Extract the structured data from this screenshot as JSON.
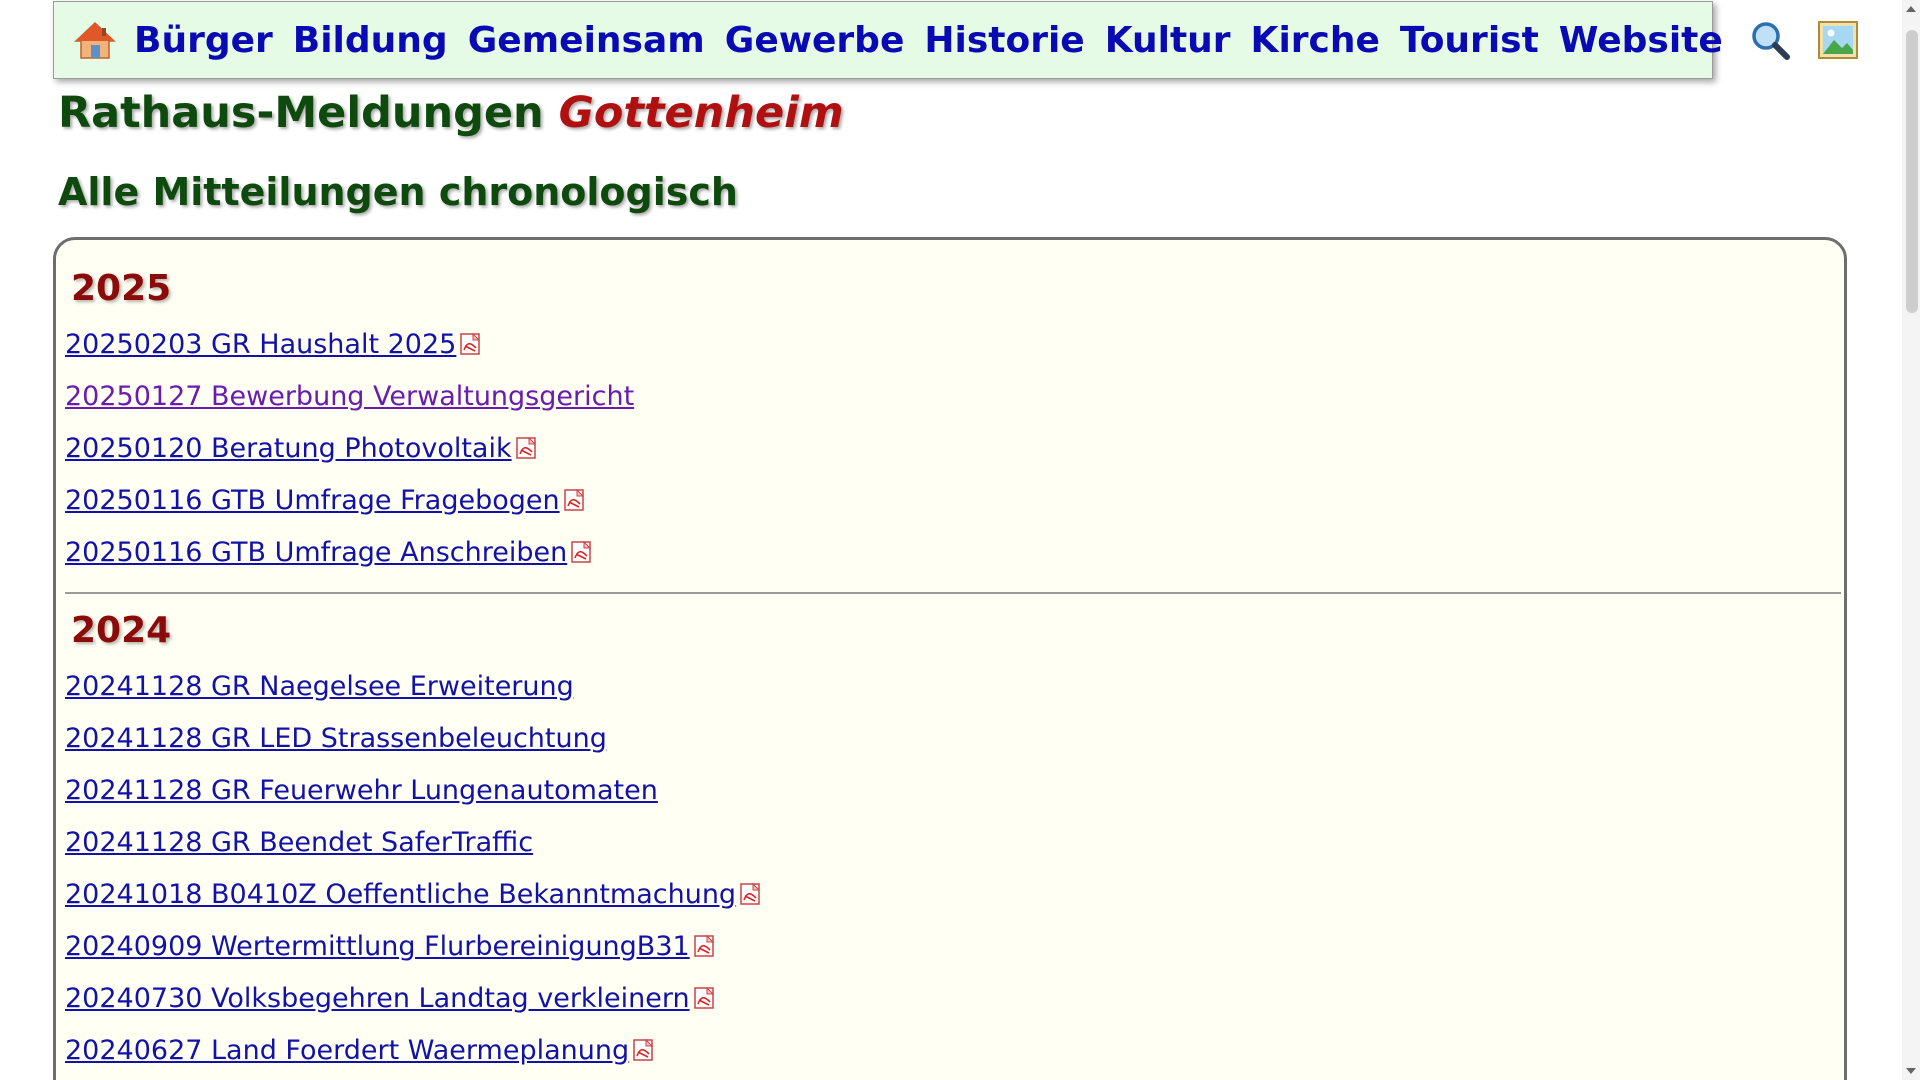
{
  "nav": {
    "home_icon": "home-icon",
    "items": [
      {
        "label": "Bürger"
      },
      {
        "label": "Bildung"
      },
      {
        "label": "Gemeinsam"
      },
      {
        "label": "Gewerbe"
      },
      {
        "label": "Historie"
      },
      {
        "label": "Kultur"
      },
      {
        "label": "Kirche"
      },
      {
        "label": "Tourist"
      },
      {
        "label": "Website"
      }
    ],
    "search_icon": "magnifier-icon",
    "image_icon": "picture-icon"
  },
  "header": {
    "title": "Rathaus-Meldungen",
    "town": "Gottenheim",
    "subtitle": "Alle Mitteilungen chronologisch"
  },
  "years": [
    {
      "year": "2025",
      "entries": [
        {
          "label": "20250203 GR Haushalt 2025",
          "pdf": true,
          "visited": false
        },
        {
          "label": "20250127 Bewerbung Verwaltungsgericht",
          "pdf": false,
          "visited": true
        },
        {
          "label": "20250120 Beratung Photovoltaik",
          "pdf": true,
          "visited": false
        },
        {
          "label": "20250116 GTB Umfrage Fragebogen",
          "pdf": true,
          "visited": false
        },
        {
          "label": "20250116 GTB Umfrage Anschreiben",
          "pdf": true,
          "visited": false
        }
      ]
    },
    {
      "year": "2024",
      "entries": [
        {
          "label": "20241128 GR Naegelsee Erweiterung",
          "pdf": false,
          "visited": false
        },
        {
          "label": "20241128 GR LED Strassenbeleuchtung",
          "pdf": false,
          "visited": false
        },
        {
          "label": "20241128 GR Feuerwehr Lungenautomaten",
          "pdf": false,
          "visited": false
        },
        {
          "label": "20241128 GR Beendet SaferTraffic",
          "pdf": false,
          "visited": false
        },
        {
          "label": "20241018 B0410Z Oeffentliche Bekanntmachung",
          "pdf": true,
          "visited": false
        },
        {
          "label": "20240909 Wertermittlung FlurbereinigungB31",
          "pdf": true,
          "visited": false
        },
        {
          "label": "20240730 Volksbegehren Landtag verkleinern",
          "pdf": true,
          "visited": false
        },
        {
          "label": "20240627 Land Foerdert Waermeplanung",
          "pdf": true,
          "visited": false
        }
      ]
    }
  ],
  "colors": {
    "nav_bg": "#e6fbe6",
    "nav_link": "#0a0ab4",
    "title_green": "#0e4a0e",
    "title_red": "#b01010",
    "year_red": "#8b0b0b",
    "link": "#1212a8",
    "link_visited": "#6a1bb0",
    "content_bg": "#fffff3"
  }
}
